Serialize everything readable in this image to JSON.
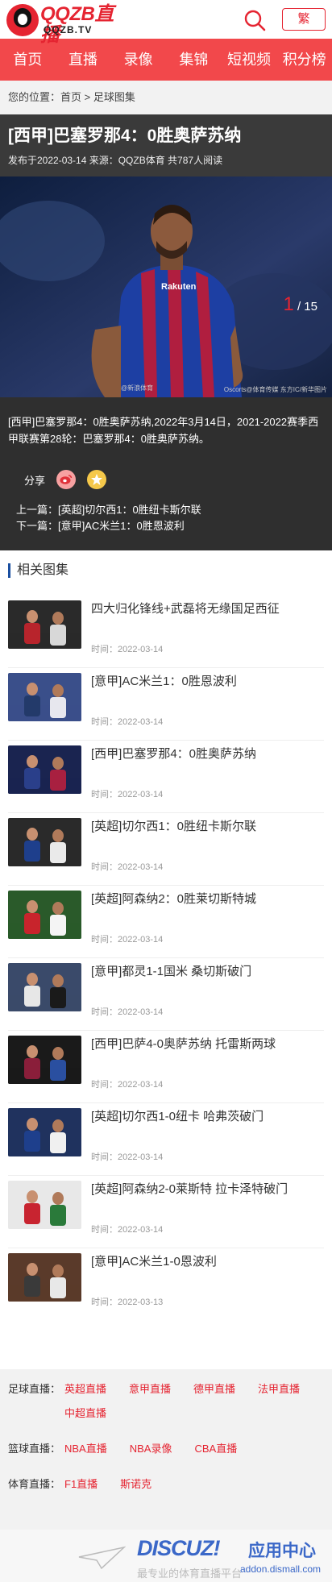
{
  "header": {
    "logo_text": "QQZB直播",
    "logo_sub": "QQZB.TV",
    "lang_button": "繁"
  },
  "nav": [
    "首页",
    "直播",
    "录像",
    "集锦",
    "短视频",
    "积分榜"
  ],
  "breadcrumb": "您的位置：首页 > 足球图集",
  "article": {
    "title": "[西甲]巴塞罗那4：0胜奥萨苏纳",
    "meta": "发布于2022-03-14 来源：QQZB体育 共787人阅读",
    "counter_current": "1",
    "counter_total": "/ 15",
    "photo_credit": "Oscorts@体育传媒  东方IC/新华图片",
    "photo_weibo": "@新浪体育",
    "description": "[西甲]巴塞罗那4：0胜奥萨苏纳,2022年3月14日，2021-2022赛季西甲联赛第28轮：巴塞罗那4：0胜奥萨苏纳。",
    "share_label": "分享",
    "prev": "上一篇：[英超]切尔西1：0胜纽卡斯尔联",
    "next": "下一篇：[意甲]AC米兰1：0胜恩波利"
  },
  "related": {
    "title": "相关图集",
    "items": [
      {
        "title": "四大归化锋线+武磊将无缘国足西征",
        "time": "时间：2022-03-14"
      },
      {
        "title": "[意甲]AC米兰1：0胜恩波利",
        "time": "时间：2022-03-14"
      },
      {
        "title": "[西甲]巴塞罗那4：0胜奥萨苏纳",
        "time": "时间：2022-03-14"
      },
      {
        "title": "[英超]切尔西1：0胜纽卡斯尔联",
        "time": "时间：2022-03-14"
      },
      {
        "title": "[英超]阿森纳2：0胜莱切斯特城",
        "time": "时间：2022-03-14"
      },
      {
        "title": "[意甲]都灵1-1国米 桑切斯破门",
        "time": "时间：2022-03-14"
      },
      {
        "title": "[西甲]巴萨4-0奥萨苏纳 托雷斯两球",
        "time": "时间：2022-03-14"
      },
      {
        "title": "[英超]切尔西1-0纽卡 哈弗茨破门",
        "time": "时间：2022-03-14"
      },
      {
        "title": "[英超]阿森纳2-0莱斯特 拉卡泽特破门",
        "time": "时间：2022-03-14"
      },
      {
        "title": "[意甲]AC米兰1-0恩波利",
        "time": "时间：2022-03-13"
      }
    ]
  },
  "footer": {
    "football_label": "足球直播：",
    "football_links": [
      "英超直播",
      "意甲直播",
      "德甲直播",
      "法甲直播",
      "中超直播"
    ],
    "basketball_label": "篮球直播：",
    "basketball_links": [
      "NBA直播",
      "NBA录像",
      "CBA直播"
    ],
    "sports_label": "体育直播：",
    "sports_links": [
      "F1直播",
      "斯诺克"
    ]
  },
  "watermark": {
    "brand": "DISCUZ!",
    "app_center": "应用中心",
    "url": "addon.dismall.com",
    "slogan": "最专业的体育直播平台"
  },
  "colors": {
    "brand_red": "#e52431",
    "nav_red": "#f2484b",
    "dark_bg": "#2f2f2f",
    "section_accent": "#1a4fa0"
  }
}
